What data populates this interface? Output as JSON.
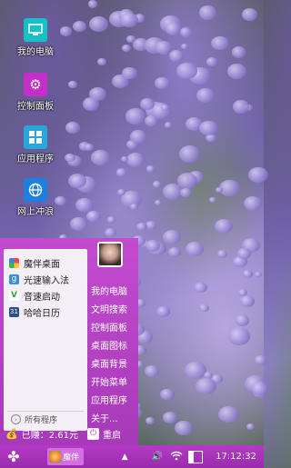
{
  "desktop": {
    "icons": [
      {
        "label": "我的电脑",
        "icon": "computer-icon",
        "color": "#17c0c9"
      },
      {
        "label": "控制面板",
        "icon": "gear-icon",
        "color": "#c42ec9"
      },
      {
        "label": "应用程序",
        "icon": "apps-grid-icon",
        "color": "#2aa7d8"
      },
      {
        "label": "网上冲浪",
        "icon": "globe-icon",
        "color": "#1f7fe0"
      }
    ]
  },
  "start_menu": {
    "apps": [
      {
        "label": "魔伴桌面",
        "icon": "pinwheel-icon"
      },
      {
        "label": "光速输入法",
        "icon": "keyboard-icon"
      },
      {
        "label": "音速启动",
        "icon": "launcher-icon"
      },
      {
        "label": "哈哈日历",
        "icon": "calendar-icon"
      }
    ],
    "all_programs_label": "所有程序",
    "right_items": [
      "我的电脑",
      "文明搜索",
      "控制面板",
      "桌面图标",
      "桌面背景",
      "开始菜单",
      "应用程序",
      "关于..."
    ],
    "earned_label": "已赚：2.61元",
    "restart_label": "重启",
    "accent_color": "#a63ab8"
  },
  "taskbar": {
    "task_label": "魔伴",
    "clock": "17:12:32",
    "battery_level": 0.35
  }
}
